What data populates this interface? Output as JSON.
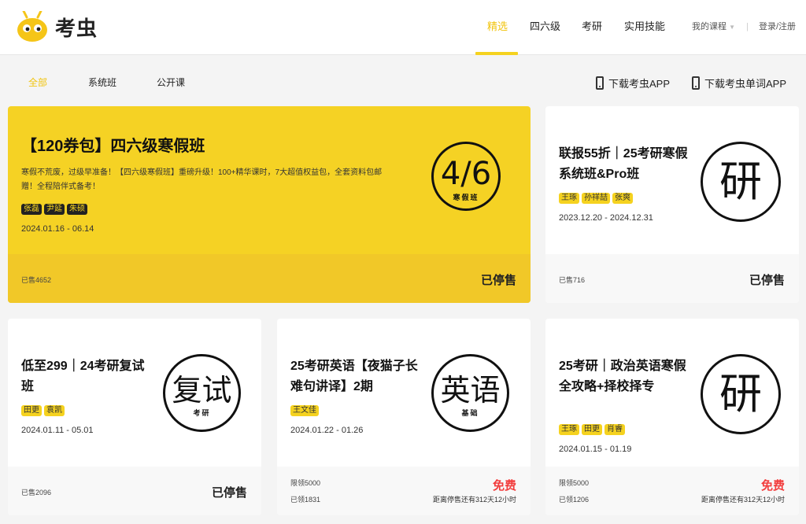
{
  "brand": {
    "logo_text": "考虫",
    "accent": "#f5d21f"
  },
  "nav": {
    "items": [
      {
        "label": "精选",
        "active": true
      },
      {
        "label": "四六级"
      },
      {
        "label": "考研"
      },
      {
        "label": "实用技能"
      }
    ],
    "my_courses": "我的课程",
    "dropdown_glyph": "▼",
    "separator": "|",
    "login": "登录/注册"
  },
  "filters": {
    "items": [
      {
        "label": "全部",
        "active": true
      },
      {
        "label": "系统班"
      },
      {
        "label": "公开课"
      }
    ],
    "download_app": "下载考虫APP",
    "download_vocab_app": "下载考虫单词APP"
  },
  "cards": [
    {
      "title": "【120券包】四六级寒假班",
      "desc": "寒假不荒废，过级早准备！【四六级寒假班】重磅升级！100+精华课时，7大超值权益包，全套资料包邮赠！全程陪伴式备考！",
      "tags": [
        "张磊",
        "尹延",
        "朱硕"
      ],
      "date": "2024.01.16 - 06.14",
      "stamp_big": "4/6",
      "stamp_small": "寒假班",
      "sold": "已售4652",
      "status": "已停售"
    },
    {
      "title": "联报55折｜25考研寒假系统班&Pro班",
      "tags": [
        "王琢",
        "孙祥喆",
        "张爽"
      ],
      "date": "2023.12.20 - 2024.12.31",
      "stamp_big": "研",
      "sold": "已售716",
      "status": "已停售"
    },
    {
      "title": "低至299｜24考研复试班",
      "tags": [
        "田更",
        "袁凯"
      ],
      "date": "2024.01.11 - 05.01",
      "stamp_big": "复试",
      "stamp_small": "考研",
      "sold": "已售2096",
      "status": "已停售"
    },
    {
      "title": "25考研英语【夜猫子长难句讲译】2期",
      "tags": [
        "王文佳"
      ],
      "date": "2024.01.22 - 01.26",
      "stamp_big": "英语",
      "stamp_small": "基础",
      "limit": "限领5000",
      "claimed": "已领1831",
      "price": "免费",
      "countdown": "距离停售还有312天12小时"
    },
    {
      "title": "25考研｜政治英语寒假全攻略+择校择专",
      "tags": [
        "王琢",
        "田更",
        "肖睿"
      ],
      "date": "2024.01.15 - 01.19",
      "stamp_big": "研",
      "limit": "限领5000",
      "claimed": "已领1206",
      "price": "免费",
      "countdown": "距离停售还有312天12小时"
    }
  ]
}
